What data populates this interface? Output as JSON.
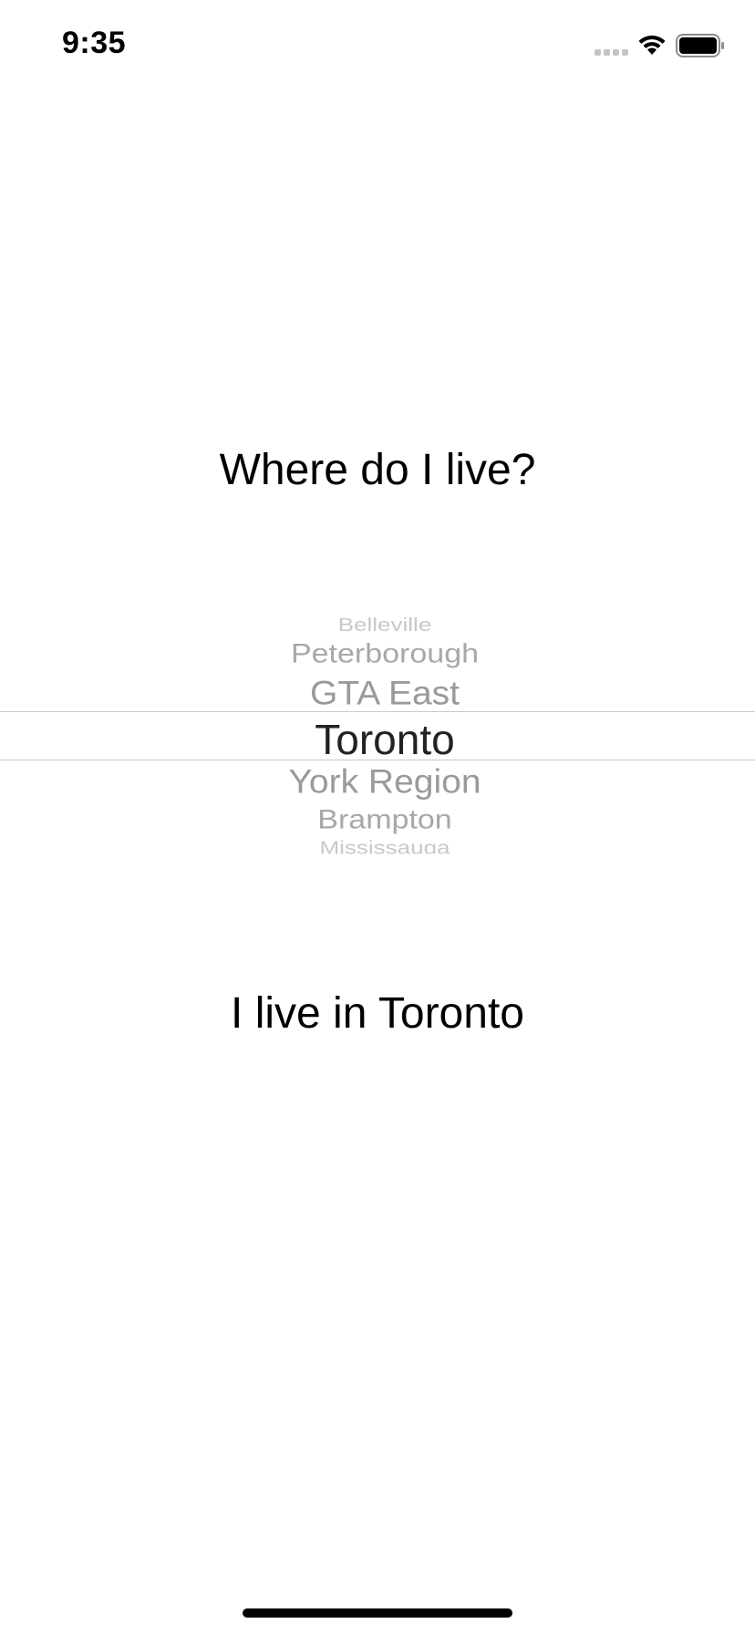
{
  "status_bar": {
    "time": "9:35",
    "icons": [
      "cellular-signal-icon",
      "wifi-icon",
      "battery-icon"
    ]
  },
  "question": "Where do I live?",
  "picker": {
    "items": [
      "Belleville",
      "Peterborough",
      "GTA East",
      "Toronto",
      "York Region",
      "Brampton",
      "Mississauga"
    ],
    "selected": "Toronto"
  },
  "answer": "I live in Toronto",
  "colors": {
    "background": "#ffffff",
    "text": "#000000",
    "picker_selected": "#222222",
    "picker_faded": "#9a9a9a",
    "separator": "#c7c7cc"
  }
}
